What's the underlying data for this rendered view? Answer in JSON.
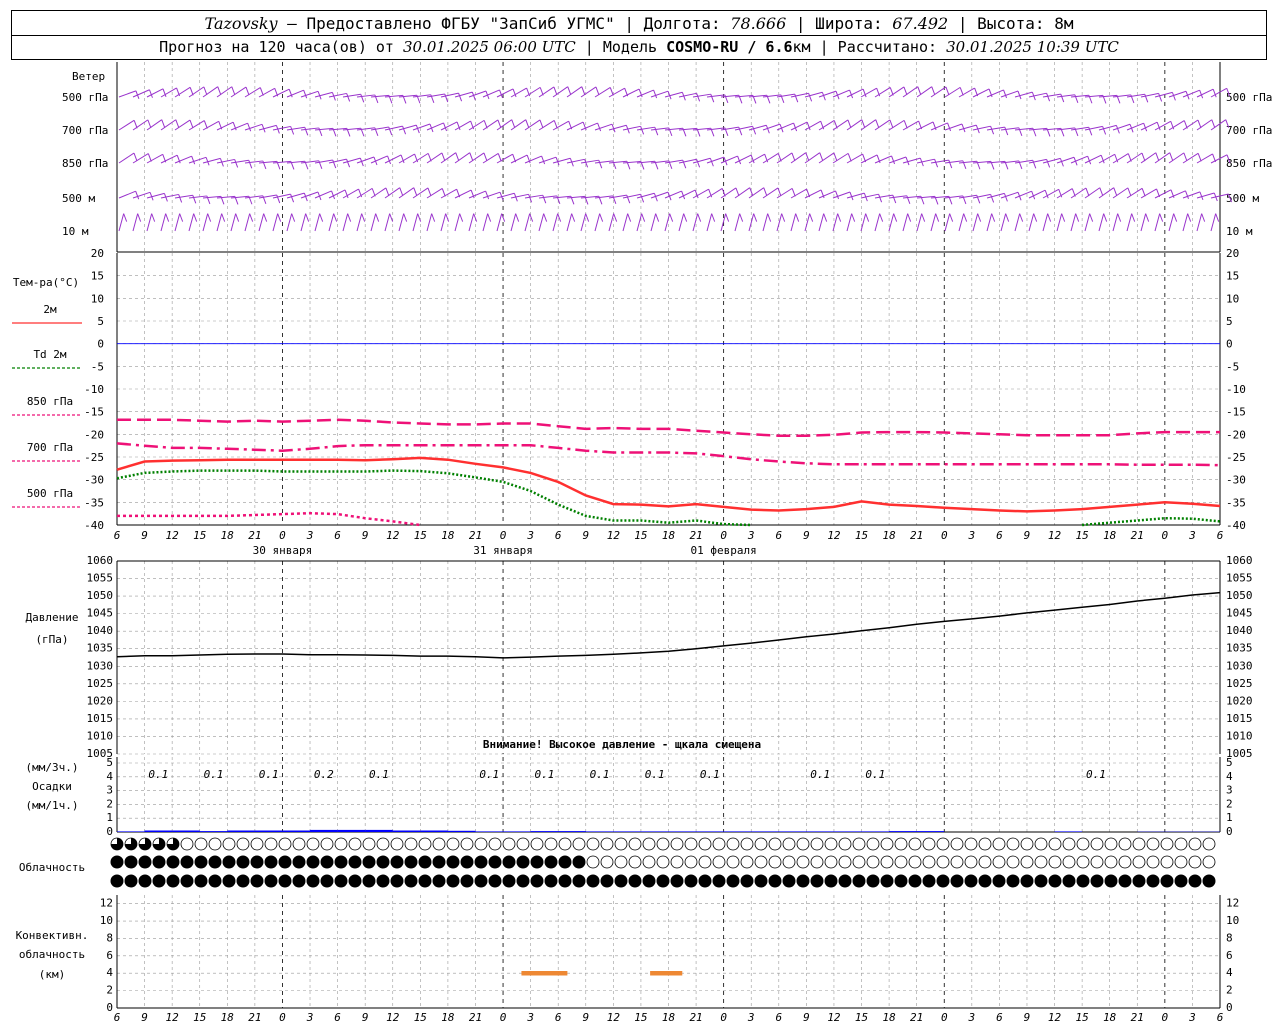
{
  "header": {
    "station": "Tazovsky",
    "provider": " – Предоставлено ФГБУ \"ЗапСиб УГМС\" | Долгота: ",
    "lon": "78.666",
    "lat_label": " | Широта: ",
    "lat": "67.492",
    "alt_label": " | Высота: 8м",
    "forecast_label": "Прогноз на 120 часа(ов) от ",
    "forecast_from": "30.01.2025 06:00 UTC",
    "model_label": " | Модель ",
    "model": "COSMO-RU / 6.6",
    "model_unit": "км | Рассчитано: ",
    "computed": "30.01.2025 10:39 UTC"
  },
  "labels": {
    "wind": "Ветер",
    "levels": [
      "500 гПа",
      "700 гПа",
      "850 гПа",
      "500 м",
      "10 м"
    ],
    "temp": "Тем-ра(°C)",
    "legend": [
      "2м",
      "Td 2м",
      "850 гПа",
      "700 гПа",
      "500 гПа"
    ],
    "pressure": "Давление",
    "pressure_unit": "(гПа)",
    "warning": "Внимание! Высокое давление - щкала смещена",
    "precip_unit3": "(мм/3ч.)",
    "precip": "Осадки",
    "precip_unit1": "(мм/1ч.)",
    "cloud": "Облачность",
    "conv1": "Конвективн.",
    "conv2": "облачность",
    "conv3": "(км)"
  },
  "colors": {
    "t2m": "#ff3030",
    "td": "#008000",
    "t850": "#ee1177",
    "t700": "#ee1177",
    "t500": "#ee1177",
    "pressure": "#000000",
    "wind": "#9933cc",
    "precip": "#0000ff",
    "conv": "#ee8833",
    "zero": "#0000ff"
  },
  "chart_data": [
    {
      "type": "line",
      "name": "temperature",
      "xlabel": "",
      "ylabel": "Тем-ра(°C)",
      "ylim": [
        -40,
        20
      ],
      "yticks": [
        20,
        15,
        10,
        5,
        0,
        -5,
        -10,
        -15,
        -20,
        -25,
        -30,
        -35,
        -40
      ],
      "x_hours": [
        0,
        3,
        6,
        9,
        12,
        15,
        18,
        21,
        24,
        27,
        30,
        33,
        36,
        39,
        42,
        45,
        48,
        51,
        54,
        57,
        60,
        63,
        66,
        69,
        72,
        75,
        78,
        81,
        84,
        87,
        90,
        93,
        96,
        99,
        102,
        105,
        108,
        111,
        114,
        117,
        120
      ],
      "x_tick_labels": [
        "6",
        "9",
        "12",
        "15",
        "18",
        "21",
        "0",
        "3",
        "6",
        "9",
        "12",
        "15",
        "18",
        "21",
        "0",
        "3",
        "6",
        "9",
        "12",
        "15",
        "18",
        "21",
        "0",
        "3",
        "6",
        "9",
        "12",
        "15",
        "18",
        "21",
        "0",
        "3",
        "6",
        "9",
        "12",
        "15",
        "18",
        "21",
        "0",
        "3",
        "6",
        "9",
        "12"
      ],
      "date_labels": [
        "30 января",
        "31 января",
        "01 февраля"
      ],
      "series": [
        {
          "name": "2м",
          "values": [
            -27.8,
            -26,
            -25.8,
            -25.7,
            -25.6,
            -25.6,
            -25.6,
            -25.6,
            -25.6,
            -25.7,
            -25.5,
            -25.2,
            -25.6,
            -26.5,
            -27.3,
            -28.5,
            -30.5,
            -33.5,
            -35.4,
            -35.5,
            -35.9,
            -35.4,
            -36.0,
            -36.6,
            -36.8,
            -36.5,
            -36.0,
            -34.8,
            -35.5,
            -35.8,
            -36.2,
            -36.5,
            -36.8,
            -37.0,
            -36.8,
            -36.5,
            -36.0,
            -35.5,
            -35.0,
            -35.3,
            -35.8
          ]
        },
        {
          "name": "Td 2м",
          "values": [
            -29.7,
            -28.5,
            -28.2,
            -28,
            -28,
            -28,
            -28.2,
            -28.2,
            -28.2,
            -28.2,
            -28,
            -28.1,
            -28.6,
            -29.5,
            -30.5,
            -32.5,
            -35.5,
            -38,
            -39,
            -39,
            -39.5,
            -39,
            -39.8,
            -40,
            null,
            null,
            null,
            null,
            null,
            null,
            null,
            null,
            null,
            null,
            null,
            -40,
            -39.5,
            -39,
            -38.5,
            -38.6,
            -39.2
          ]
        },
        {
          "name": "850 гПа",
          "values": [
            -16.8,
            -16.8,
            -16.8,
            -17,
            -17.2,
            -17,
            -17.2,
            -17,
            -16.8,
            -17,
            -17.4,
            -17.6,
            -17.8,
            -17.8,
            -17.6,
            -17.6,
            -18.2,
            -18.8,
            -18.6,
            -18.8,
            -18.8,
            -19.2,
            -19.6,
            -20,
            -20.3,
            -20.3,
            -20.1,
            -19.6,
            -19.5,
            -19.5,
            -19.6,
            -19.8,
            -20,
            -20.2,
            -20.2,
            -20.2,
            -20.2,
            -19.8,
            -19.5,
            -19.5,
            -19.5
          ]
        },
        {
          "name": "700 гПа",
          "values": [
            -22,
            -22.5,
            -23,
            -23,
            -23.2,
            -23.4,
            -23.6,
            -23.2,
            -22.6,
            -22.4,
            -22.4,
            -22.4,
            -22.4,
            -22.4,
            -22.4,
            -22.4,
            -23,
            -23.6,
            -24,
            -24,
            -24,
            -24.2,
            -24.8,
            -25.5,
            -26,
            -26.4,
            -26.6,
            -26.6,
            -26.6,
            -26.6,
            -26.6,
            -26.6,
            -26.6,
            -26.6,
            -26.6,
            -26.6,
            -26.6,
            -26.7,
            -26.7,
            -26.7,
            -26.8
          ]
        },
        {
          "name": "500 гПа",
          "values": [
            -38,
            -38,
            -38,
            -38,
            -38,
            -37.8,
            -37.6,
            -37.4,
            -37.6,
            -38.5,
            -39.2,
            -40,
            null,
            null,
            null,
            null,
            null,
            null,
            null,
            null,
            null,
            null,
            null,
            null,
            null,
            null,
            null,
            null,
            null,
            null,
            null,
            null,
            null,
            null,
            null,
            null,
            null,
            null,
            null,
            null,
            null
          ]
        }
      ]
    },
    {
      "type": "line",
      "name": "pressure",
      "ylabel": "Давление (гПа)",
      "ylim": [
        1005,
        1060
      ],
      "yticks": [
        1060,
        1055,
        1050,
        1045,
        1040,
        1035,
        1030,
        1025,
        1020,
        1015,
        1010,
        1005
      ],
      "series": [
        {
          "name": "Давление",
          "values": [
            1032.7,
            1033,
            1033,
            1033.2,
            1033.4,
            1033.5,
            1033.5,
            1033.3,
            1033.3,
            1033.2,
            1033.1,
            1032.9,
            1032.9,
            1032.7,
            1032.4,
            1032.6,
            1032.9,
            1033.1,
            1033.4,
            1033.8,
            1034.3,
            1035,
            1035.8,
            1036.6,
            1037.5,
            1038.4,
            1039.2,
            1040.1,
            1041,
            1042,
            1042.8,
            1043.5,
            1044.3,
            1045.2,
            1046,
            1046.8,
            1047.6,
            1048.6,
            1049.4,
            1050.3,
            1051
          ]
        }
      ]
    },
    {
      "type": "bar",
      "name": "precipitation",
      "ylabel": "Осадки (мм/3ч.)",
      "ylim": [
        0,
        5
      ],
      "yticks": [
        5,
        4,
        3,
        2,
        1,
        0
      ],
      "labels": [
        {
          "hour": 6,
          "text": "0.1"
        },
        {
          "hour": 12,
          "text": "0.1"
        },
        {
          "hour": 18,
          "text": "0.1"
        },
        {
          "hour": 24,
          "text": "0.2"
        },
        {
          "hour": 30,
          "text": "0.1"
        },
        {
          "hour": 42,
          "text": "0.1"
        },
        {
          "hour": 48,
          "text": "0.1"
        },
        {
          "hour": 54,
          "text": "0.1"
        },
        {
          "hour": 60,
          "text": "0.1"
        },
        {
          "hour": 66,
          "text": "0.1"
        },
        {
          "hour": 78,
          "text": "0.1"
        },
        {
          "hour": 84,
          "text": "0.1"
        },
        {
          "hour": 108,
          "text": "0.1"
        }
      ],
      "hourly": [
        0.02,
        0.05,
        0.05,
        0.03,
        0.05,
        0.05,
        0.05,
        0.07,
        0.07,
        0.07,
        0.05,
        0.05,
        0.04,
        0.02,
        0.02,
        0.03,
        0.03,
        0.02,
        0.02,
        0.02,
        0.02,
        0.02,
        0.02,
        0.02,
        0.02,
        0.02,
        0.02,
        0.02,
        0.03,
        0.03,
        0,
        0,
        0,
        0,
        0.02,
        0,
        0,
        0.01,
        0.01,
        0.01,
        0
      ]
    },
    {
      "type": "bar",
      "name": "convective_cloud",
      "ylabel": "Конвективн. облачность (км)",
      "ylim": [
        0,
        13
      ],
      "yticks": [
        12,
        10,
        8,
        6,
        4,
        2,
        0
      ],
      "segments": [
        {
          "from_hour": 44,
          "to_hour": 49,
          "height_km": 4
        },
        {
          "from_hour": 58,
          "to_hour": 61.5,
          "height_km": 4
        }
      ]
    }
  ],
  "cloud_rows": {
    "top": "lllllmmmmmmmmmmmmmmmmmmmmmmmmmmmmmmmmmmmmmmmmmmmmmmmmmmmmmmmmmmmmmmmmmmmmmmmmmmmmmmmmmmmmmmmmmmmmmmmmmmmmmmmmmmmmmmmmmmmmmm",
    "mid": "ffffffffffffffffffffffffffffffffffmmmmmmmmmmmmmmmmmmmmmmmmmmmmmmmmmmmmmmmmmmmmmmmmmmmmmmmmmmmmmmmmmmmmmmmmmmmmmmmmmmmmmmmmmmmmmm",
    "low": "fffffffffffffffffffffffffffffffffffffffffffffffffffffffffffffffffffffffffffffffffffffffffffffffffffffffffffffffffffffffff"
  }
}
